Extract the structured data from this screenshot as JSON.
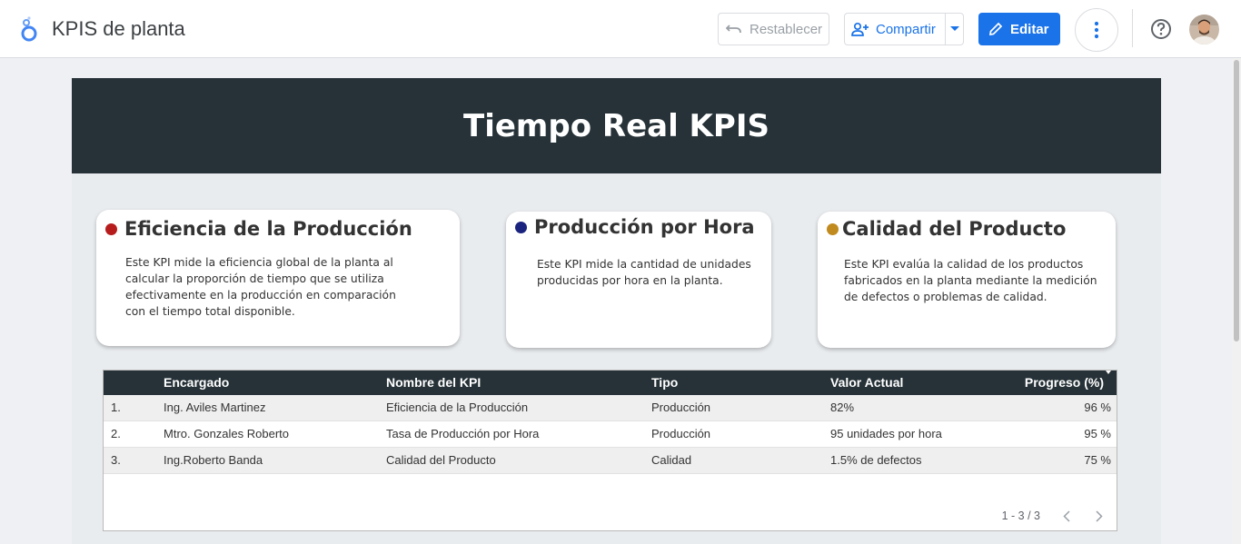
{
  "app": {
    "title": "KPIS de planta"
  },
  "toolbar": {
    "reset_label": "Restablecer",
    "share_label": "Compartir",
    "edit_label": "Editar",
    "accent": "#1a73e8"
  },
  "report": {
    "title": "Tiempo Real KPIS",
    "header_color": "#263238",
    "cards": [
      {
        "title": "Eficiencia de la Producción",
        "dot_color": "#b71c1c",
        "description": "Este KPI mide la eficiencia global de la planta al calcular la proporción de tiempo que se utiliza efectivamente en la producción en comparación con el tiempo total disponible."
      },
      {
        "title": "Producción por Hora",
        "dot_color": "#1a237e",
        "description": "Este KPI mide la cantidad de unidades producidas por hora en la planta."
      },
      {
        "title": "Calidad del Producto",
        "dot_color": "#c08a1e",
        "description": "Este KPI evalúa la calidad de los productos fabricados en la planta mediante la medición de defectos o problemas de calidad."
      }
    ],
    "table": {
      "headers": [
        "",
        "Encargado",
        "Nombre del KPI",
        "Tipo",
        "Valor Actual",
        "Progreso (%)"
      ],
      "rows": [
        [
          "1.",
          "Ing. Aviles Martinez",
          "Eficiencia de la Producción",
          "Producción",
          "82%",
          "96 %"
        ],
        [
          "2.",
          "Mtro. Gonzales Roberto",
          "Tasa de Producción por Hora",
          "Producción",
          "95 unidades por hora",
          "95 %"
        ],
        [
          "3.",
          "Ing.Roberto Banda",
          "Calidad del Producto",
          "Calidad",
          "1.5% de defectos",
          "75 %"
        ]
      ],
      "pagination": "1 - 3 / 3"
    }
  }
}
